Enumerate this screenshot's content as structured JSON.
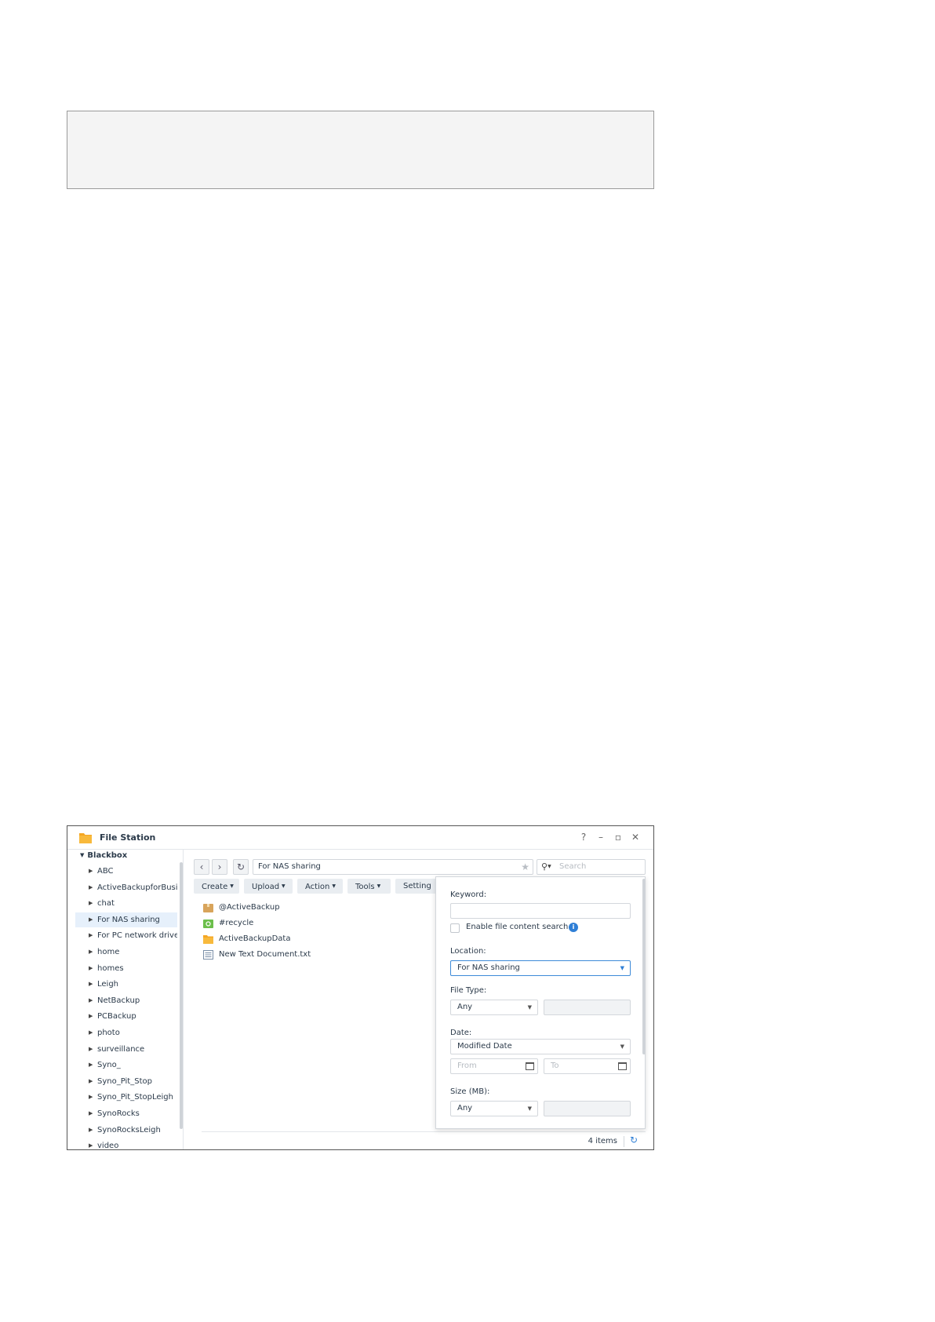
{
  "window": {
    "title": "File Station",
    "controls": [
      "?",
      "–",
      "▫",
      "✕"
    ]
  },
  "sidebar": {
    "root": "Blackbox",
    "items": [
      {
        "label": "ABC"
      },
      {
        "label": "ActiveBackupforBusiness"
      },
      {
        "label": "chat"
      },
      {
        "label": "For NAS sharing",
        "selected": true
      },
      {
        "label": "For PC network drive"
      },
      {
        "label": "home"
      },
      {
        "label": "homes"
      },
      {
        "label": "Leigh"
      },
      {
        "label": "NetBackup"
      },
      {
        "label": "PCBackup"
      },
      {
        "label": "photo"
      },
      {
        "label": "surveillance"
      },
      {
        "label": "Syno_"
      },
      {
        "label": "Syno_Pit_Stop"
      },
      {
        "label": "Syno_Pit_StopLeigh"
      },
      {
        "label": "SynoRocks"
      },
      {
        "label": "SynoRocksLeigh"
      },
      {
        "label": "video"
      }
    ]
  },
  "nav": {
    "back": "‹",
    "forward": "›",
    "refresh": "↻",
    "path": "For NAS sharing",
    "search_placeholder": "Search"
  },
  "toolbar": {
    "create": "Create",
    "upload": "Upload",
    "action": "Action",
    "tools": "Tools",
    "settings": "Setting"
  },
  "files": [
    {
      "name": "@ActiveBackup",
      "icon": "package-folder-icon"
    },
    {
      "name": "#recycle",
      "icon": "recycle-folder-icon"
    },
    {
      "name": "ActiveBackupData",
      "icon": "folder-icon"
    },
    {
      "name": "New Text Document.txt",
      "icon": "text-file-icon"
    }
  ],
  "status": {
    "count": "4 items"
  },
  "search_panel": {
    "keyword_label": "Keyword:",
    "keyword_value": "",
    "content_search_label": "Enable file content search",
    "location_label": "Location:",
    "location_value": "For NAS sharing",
    "file_type_label": "File Type:",
    "file_type_value": "Any",
    "date_label": "Date:",
    "date_value": "Modified Date",
    "from_placeholder": "From",
    "to_placeholder": "To",
    "size_label": "Size (MB):",
    "size_value": "Any"
  },
  "colors": {
    "accent": "#2f7fd6",
    "folder": "#f5a623",
    "selected_bg": "#e6f0fb"
  }
}
